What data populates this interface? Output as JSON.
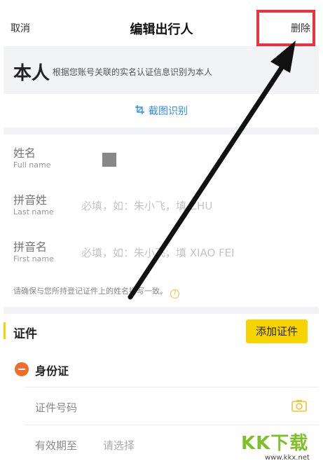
{
  "header": {
    "cancel": "取消",
    "title": "编辑出行人",
    "delete": "删除"
  },
  "self_banner": {
    "big": "本人",
    "note": "根据您账号关联的实名认证信息识别为本人"
  },
  "ocr_label": "截图识别",
  "fields": {
    "full_name": {
      "label_cn": "姓名",
      "label_en": "Full name"
    },
    "last_name": {
      "label_cn": "拼音姓",
      "label_en": "Last name",
      "placeholder": "必填，如：朱小飞，填 ZHU"
    },
    "first_name": {
      "label_cn": "拼音名",
      "label_en": "First name",
      "placeholder": "必填，如：朱小飞，填 XIAO FEI"
    }
  },
  "hint": "请确保与您所持登记证件上的姓名拼写一致。",
  "certificate": {
    "section_title": "证件",
    "add_button": "添加证件",
    "id_type": "身份证",
    "id_number_label": "证件号码",
    "validity_label": "有效期至",
    "validity_placeholder": "请选择"
  },
  "watermark": {
    "logo": "KK下载",
    "url": "www.kkx.net"
  },
  "colors": {
    "highlight_box": "#e8343f",
    "accent_yellow": "#f7d300",
    "link_blue": "#2d8cf0",
    "minus_orange": "#f06c2a"
  }
}
